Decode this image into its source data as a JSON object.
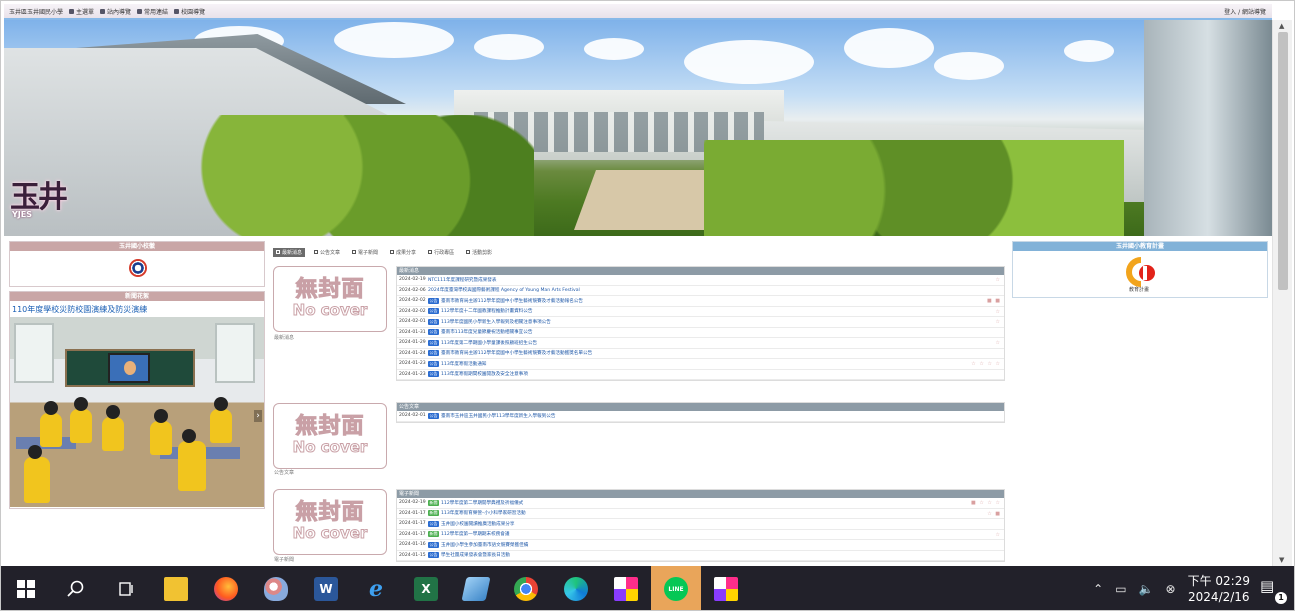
{
  "topbar": {
    "items": [
      "玉井區玉井國民小學",
      "主選單",
      "站內導覽",
      "常用連結",
      "校園導覽"
    ],
    "right": "登入 / 網站導覽"
  },
  "banner": {
    "logo_text": "玉井",
    "logo_sub": "YJES"
  },
  "left": {
    "school_panel_title": "玉井國小校徽",
    "news_panel_title": "新聞花絮",
    "news_headline": "110年度學校災防校園演練及防災演練"
  },
  "center": {
    "tabs": [
      "最新消息",
      "公告文章",
      "電子新聞",
      "成果分享",
      "行政專區",
      "活動剪影"
    ],
    "no_cover_zh": "無封面",
    "no_cover_en": "No cover",
    "sections": [
      {
        "header": "最新消息",
        "caption": "最新消息",
        "rows": [
          {
            "date": "2024-02-19",
            "badge": "",
            "title": "NTC111年度課程研究暨成果發表",
            "acts": "☆"
          },
          {
            "date": "2024-02-06",
            "badge": "",
            "title": "2024年度臺灣學校與國際藝術課程 Agency of Young Man Arts Festival",
            "acts": ""
          },
          {
            "date": "2024-02-02",
            "badge": "公告",
            "title": "臺南市教育局主辦112學年度國中小學生藝術競賽及才藝活動報名公告",
            "acts": "■ ■"
          },
          {
            "date": "2024-02-02",
            "badge": "公告",
            "title": "112學年度十二年國教課程推動計畫資料公告",
            "acts": "☆"
          },
          {
            "date": "2024-02-01",
            "badge": "公告",
            "title": "113學年度國民小學新生入學報到及相關注意事項公告",
            "acts": "☆"
          },
          {
            "date": "2024-01-31",
            "badge": "公告",
            "title": "臺南市113年度兒童節慶祝活動相關事宜公告",
            "acts": ""
          },
          {
            "date": "2024-01-29",
            "badge": "公告",
            "title": "113年度第二學期國小學童課後照顧班招生公告",
            "acts": "☆"
          },
          {
            "date": "2024-01-24",
            "badge": "公告",
            "title": "臺南市教育局主辦112學年度國中小學生藝術競賽及才藝活動獲獎名單公告",
            "acts": ""
          },
          {
            "date": "2024-01-23",
            "badge": "公告",
            "title": "113年度寒假活動通知",
            "acts": "☆ ☆ ☆ ☆"
          },
          {
            "date": "2024-01-23",
            "badge": "公告",
            "title": "113年度寒假期間校園開放及安全注意事項",
            "acts": ""
          }
        ]
      },
      {
        "header": "公告文章",
        "caption": "公告文章",
        "rows": [
          {
            "date": "2024-02-01",
            "badge": "公告",
            "title": "臺南市玉井區玉井國民小學113學年度新生入學報到公告",
            "acts": ""
          }
        ]
      },
      {
        "header": "電子新聞",
        "caption": "電子新聞",
        "rows": [
          {
            "date": "2024-02-19",
            "badge": "新聞",
            "title": "112學年度第二學期開學典禮及祈福儀式",
            "acts": "■ ☆ ☆ ☆"
          },
          {
            "date": "2024-01-17",
            "badge": "新聞",
            "title": "113年度寒假育樂營–小小科學家研習活動",
            "acts": "☆ ■"
          },
          {
            "date": "2024-01-17",
            "badge": "公告",
            "title": "玉井國小校園閱讀推廣活動成果分享",
            "acts": ""
          },
          {
            "date": "2024-01-17",
            "badge": "新聞",
            "title": "112學年度第一學期期末校務會議",
            "acts": "☆"
          },
          {
            "date": "2024-01-16",
            "badge": "公告",
            "title": "玉井國小學生參加臺南市語文競賽榮獲佳績",
            "acts": ""
          },
          {
            "date": "2024-01-15",
            "badge": "公告",
            "title": "學生社團成果發表會暨家長日活動",
            "acts": ""
          }
        ]
      }
    ]
  },
  "right": {
    "plan_panel_title": "玉井國小教育計畫"
  },
  "taskbar": {
    "apps": [
      "start",
      "search",
      "task-view",
      "file-explorer",
      "firefox",
      "paint",
      "word",
      "ie",
      "excel",
      "notepad",
      "chrome",
      "edge",
      "kalpa",
      "line",
      "kalpa2"
    ],
    "clock_time": "下午 02:29",
    "clock_date": "2024/2/16",
    "notification_count": "1"
  },
  "colors": {
    "accent_pink": "#c9a6a6",
    "accent_blue": "#82b2d8",
    "list_header": "#8d9ba6",
    "badge_blue": "#2b6cd0",
    "taskbar": "#22212a"
  }
}
